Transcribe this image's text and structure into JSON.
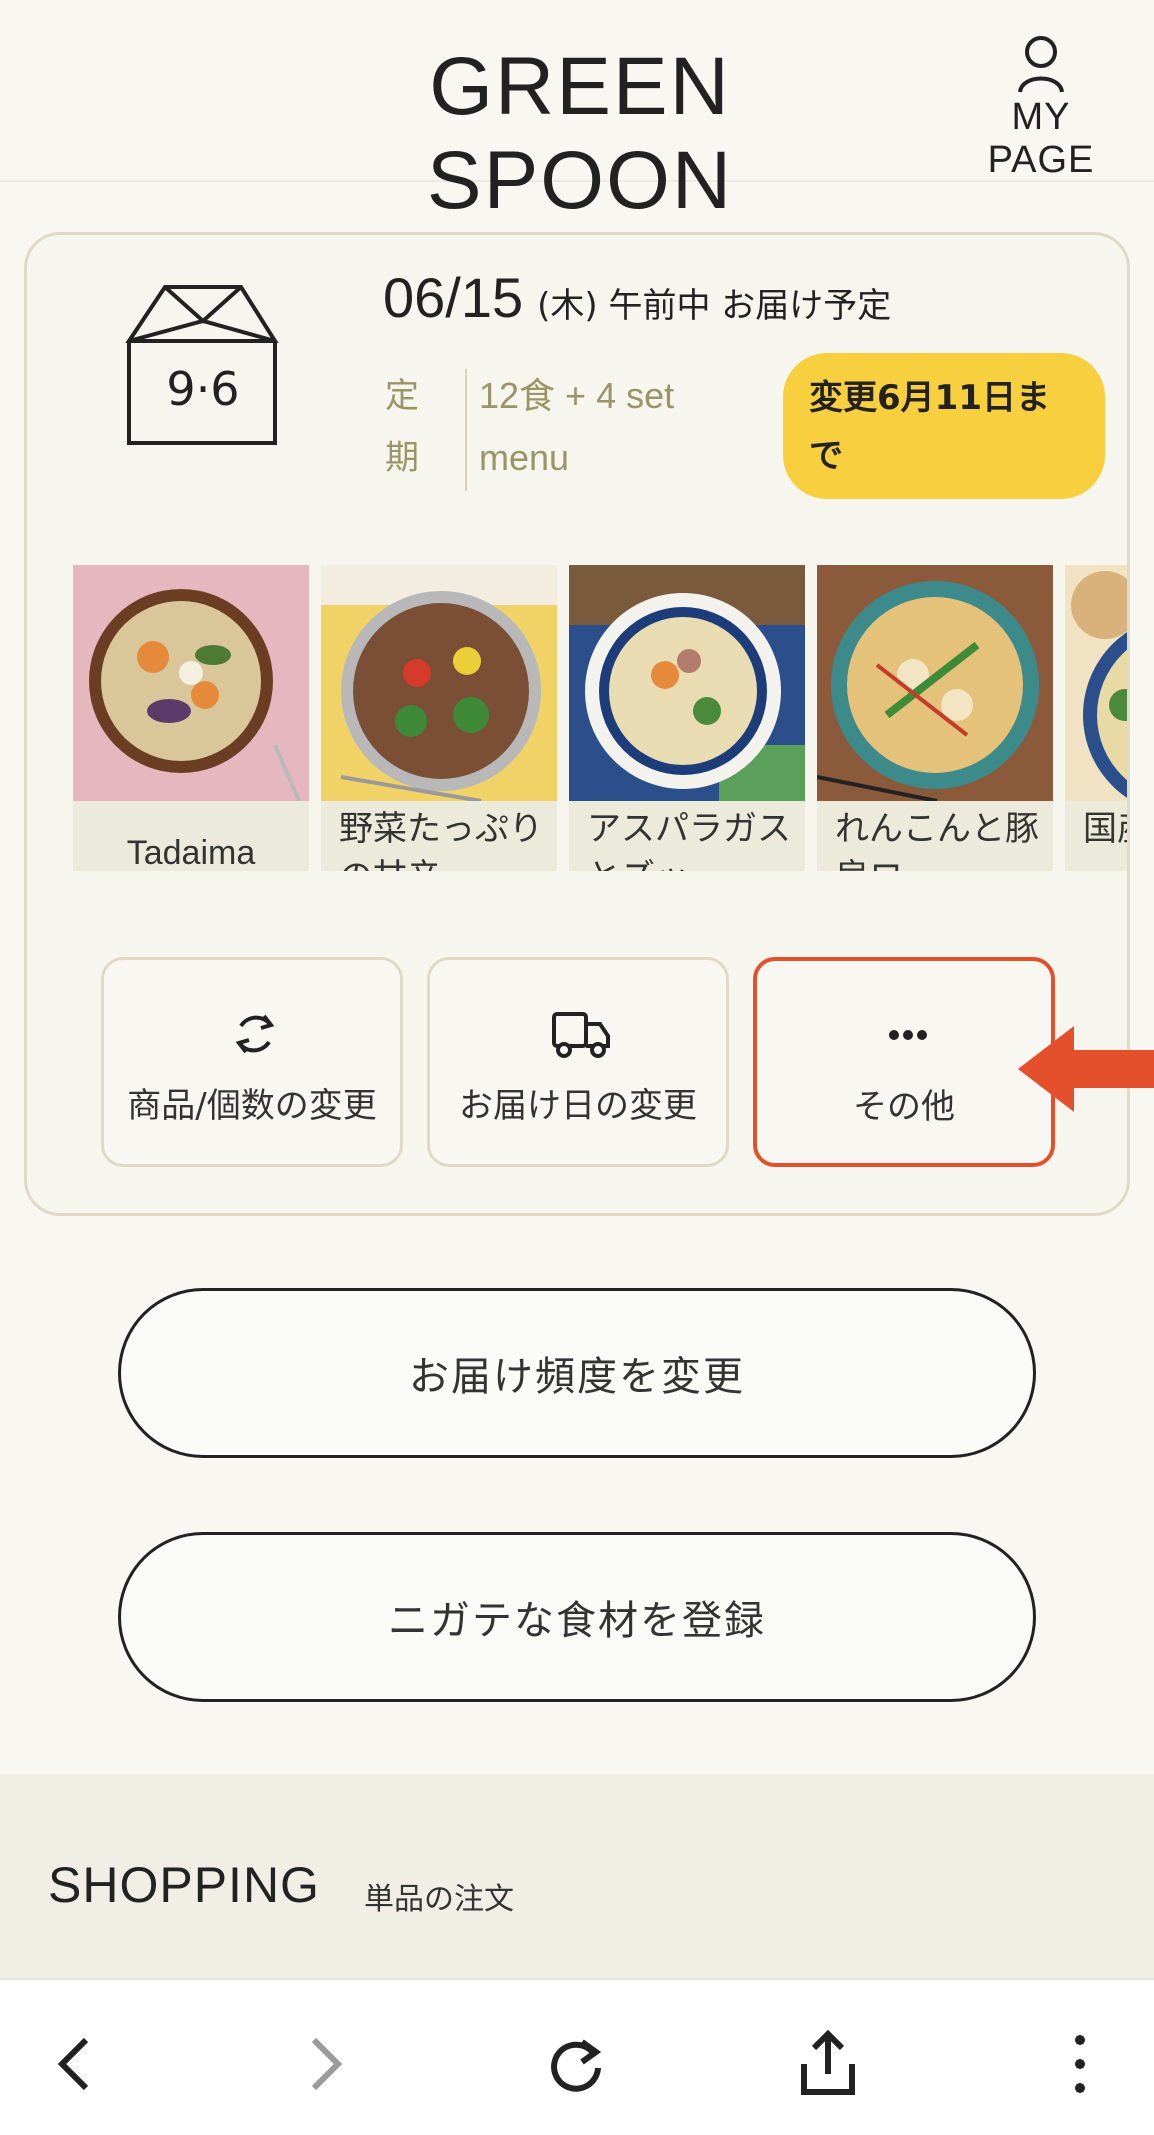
{
  "header": {
    "logo": "GREEN SPOON",
    "mypage_label": "MY PAGE"
  },
  "delivery": {
    "date": "06/15",
    "weekday_time": "(木) 午前中 お届け予定",
    "plan_kind": "定期",
    "plan_desc": "12食 + 4 set menu",
    "deadline": "変更6月11日まで",
    "accent_color": "#f7cf3f"
  },
  "menu_items": [
    {
      "name": "Tadaima"
    },
    {
      "name": "野菜たっぷりの甘辛..."
    },
    {
      "name": "アスパラガスとズッ..."
    },
    {
      "name": "れんこんと豚肩ロー..."
    },
    {
      "name": "国産と口"
    }
  ],
  "actions": [
    {
      "label": "商品/個数の変更",
      "icon": "refresh-icon"
    },
    {
      "label": "お届け日の変更",
      "icon": "truck-icon"
    },
    {
      "label": "その他",
      "icon": "more-dots-icon",
      "highlight_color": "#e4502c"
    }
  ],
  "buttons": {
    "frequency": "お届け頻度を変更",
    "dislikes": "ニガテな食材を登録"
  },
  "shopping": {
    "title": "SHOPPING",
    "subtitle": "単品の注文"
  },
  "toolbar": {
    "icons": [
      "back-icon",
      "forward-icon",
      "reload-icon",
      "share-icon",
      "more-vert-icon"
    ]
  }
}
